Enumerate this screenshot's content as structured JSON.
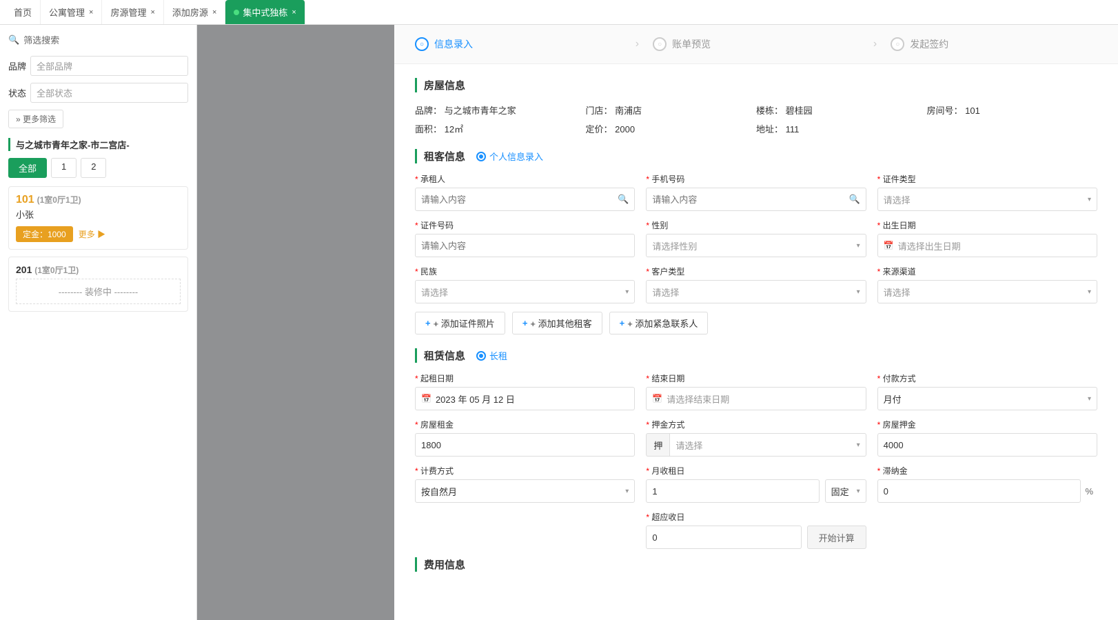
{
  "tabs": [
    {
      "id": "home",
      "label": "首页",
      "closable": false,
      "active": false
    },
    {
      "id": "apartment",
      "label": "公寓管理",
      "closable": true,
      "active": false
    },
    {
      "id": "room-mgmt",
      "label": "房源管理",
      "closable": true,
      "active": false
    },
    {
      "id": "add-room",
      "label": "添加房源",
      "closable": true,
      "active": false
    },
    {
      "id": "centralized",
      "label": "集中式独栋",
      "closable": true,
      "active": true,
      "dot": true
    }
  ],
  "sidebar": {
    "filter_label": "筛选搜索",
    "brand_label": "品牌",
    "brand_value": "全部品牌",
    "status_label": "状态",
    "status_value": "全部状态",
    "more_filter": "» 更多筛选",
    "building_title": "与之城市青年之家-市二宫店-",
    "floor_tabs": [
      "全部",
      "1",
      "2"
    ],
    "active_floor": "全部",
    "rooms": [
      {
        "id": "101",
        "spec": "(1室0厅1卫)",
        "tenant": "小张",
        "deposit_label": "定金：1000",
        "more_label": "更多 ▶"
      }
    ],
    "rooms2": [
      {
        "id": "201",
        "spec": "(1室0厅1卫)",
        "status": "-------- 装修中 --------"
      }
    ]
  },
  "modal": {
    "stepper": [
      {
        "label": "信息录入",
        "active": true
      },
      {
        "label": "账单预览",
        "active": false
      },
      {
        "label": "发起签约",
        "active": false
      }
    ],
    "arrow": "›",
    "house_section": "房屋信息",
    "house_info": {
      "brand_label": "品牌：",
      "brand_value": "与之城市青年之家",
      "store_label": "门店：",
      "store_value": "南浦店",
      "building_label": "楼栋：",
      "building_value": "碧桂园",
      "room_label": "房间号：",
      "room_value": "101",
      "area_label": "面积：",
      "area_value": "12㎡",
      "price_label": "定价：",
      "price_value": "2000",
      "address_label": "地址：",
      "address_value": "111"
    },
    "tenant_section": "租客信息",
    "tenant_radio": "个人信息录入",
    "fields": {
      "tenant_name_label": "承租人",
      "tenant_name_placeholder": "请输入内容",
      "phone_label": "手机号码",
      "phone_placeholder": "请输入内容",
      "id_type_label": "证件类型",
      "id_type_placeholder": "请选择",
      "id_number_label": "证件号码",
      "id_number_placeholder": "请输入内容",
      "gender_label": "性别",
      "gender_placeholder": "请选择性别",
      "birthday_label": "出生日期",
      "birthday_placeholder": "请选择出生日期",
      "ethnicity_label": "民族",
      "ethnicity_placeholder": "请选择",
      "customer_type_label": "客户类型",
      "customer_type_placeholder": "请选择",
      "source_label": "来源渠道",
      "source_placeholder": "请选择"
    },
    "btn_id_photo": "+ 添加证件照片",
    "btn_other_tenant": "+ 添加其他租客",
    "btn_emergency": "+ 添加紧急联系人",
    "rental_section": "租赁信息",
    "rental_radio": "长租",
    "rental_fields": {
      "start_date_label": "起租日期",
      "start_date_value": "2023 年 05 月 12 日",
      "end_date_label": "结束日期",
      "end_date_placeholder": "请选择结束日期",
      "payment_label": "付款方式",
      "payment_value": "月付",
      "rent_label": "房屋租金",
      "rent_value": "1800",
      "deposit_method_label": "押金方式",
      "deposit_prefix": "押",
      "deposit_select_placeholder": "请选择",
      "house_deposit_label": "房屋押金",
      "house_deposit_value": "4000",
      "billing_label": "计费方式",
      "billing_value": "按自然月",
      "billing_placeholder": "按自然月",
      "collect_day_label": "月收租日",
      "collect_day_value": "1",
      "collect_day_fixed": "固定",
      "late_fee_label": "滞纳金",
      "late_fee_value": "0",
      "percent_suffix": "%",
      "overdue_label": "超应收日",
      "overdue_value": "0",
      "calc_btn_label": "开始计算"
    },
    "fee_section": "费用信息"
  }
}
